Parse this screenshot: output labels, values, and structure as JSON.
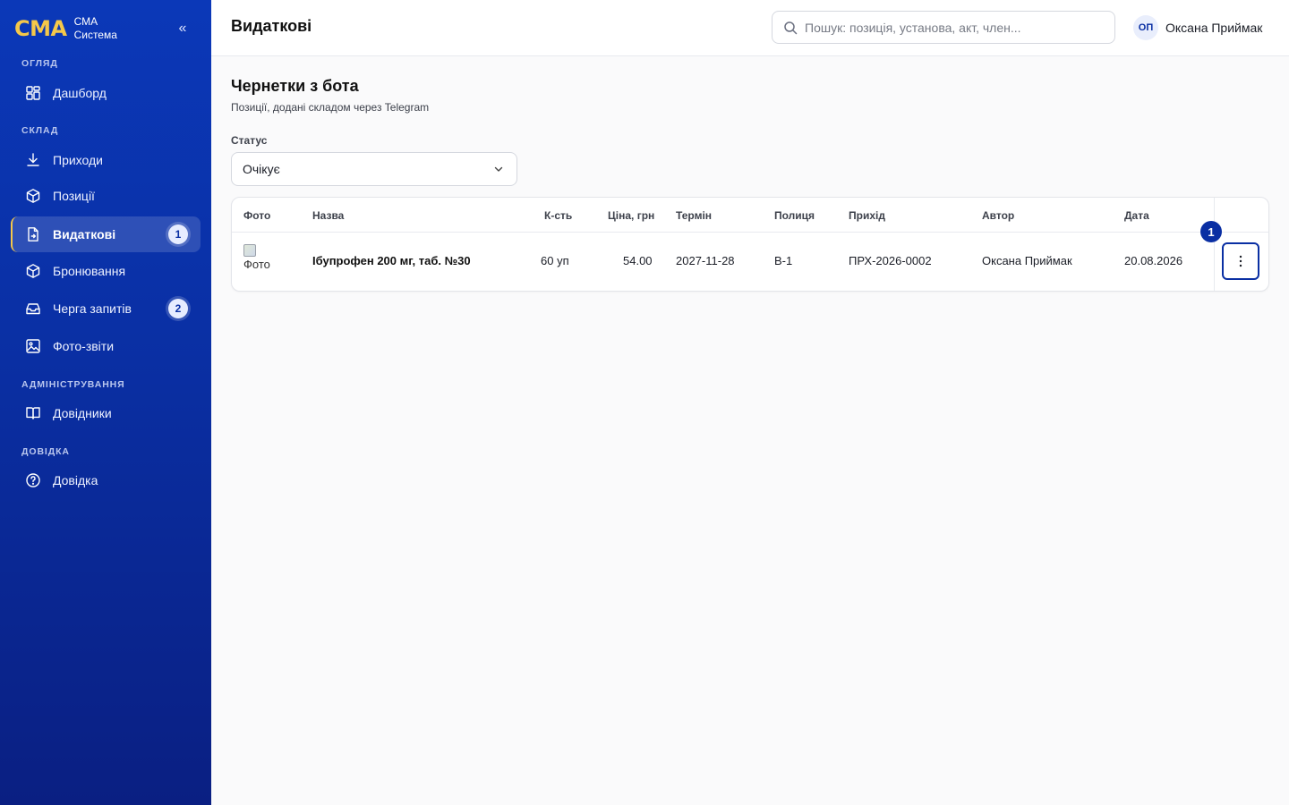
{
  "sidebar": {
    "brand_logo": "СМА",
    "brand_line1": "СМА",
    "brand_line2": "Система",
    "collapse": "«",
    "sections": {
      "overview": "ОГЛЯД",
      "warehouse": "СКЛАД",
      "admin": "АДМІНІСТРУВАННЯ",
      "help": "ДОВІДКА"
    },
    "items": [
      {
        "label": "Дашборд",
        "icon": "dashboard-icon"
      },
      {
        "label": "Приходи",
        "icon": "download-icon"
      },
      {
        "label": "Позиції",
        "icon": "box-icon"
      },
      {
        "label": "Видаткові",
        "icon": "file-out-icon",
        "badge": "1"
      },
      {
        "label": "Бронювання",
        "icon": "box-icon"
      },
      {
        "label": "Черга запитів",
        "icon": "inbox-icon",
        "badge": "2"
      },
      {
        "label": "Фото-звіти",
        "icon": "image-icon"
      },
      {
        "label": "Довідники",
        "icon": "book-icon"
      },
      {
        "label": "Довідка",
        "icon": "help-circle-icon"
      }
    ]
  },
  "header": {
    "title": "Видаткові",
    "search_placeholder": "Пошук: позиція, установа, акт, член...",
    "user_initials": "ОП",
    "user_name": "Оксана Приймак"
  },
  "main": {
    "title": "Чернетки з бота",
    "subtitle": "Позиції, додані складом через Telegram",
    "filter_label": "Статус",
    "filter_value": "Очікує",
    "table": {
      "columns": [
        "Фото",
        "Назва",
        "К-сть",
        "Ціна, грн",
        "Термін",
        "Полиця",
        "Прихід",
        "Автор",
        "Дата"
      ],
      "rows": [
        {
          "photo_alt": "Фото",
          "name": "Ібупрофен 200 мг, таб. №30",
          "qty": "60 уп",
          "price": "54.00",
          "term": "2027-11-28",
          "shelf": "В-1",
          "receipt": "ПРХ-2026-0002",
          "author": "Оксана Приймак",
          "date": "20.08.2026"
        }
      ]
    },
    "callout": "1"
  },
  "colors": {
    "accent": "#0a2fa3",
    "brand_yellow": "#f5c84a"
  }
}
